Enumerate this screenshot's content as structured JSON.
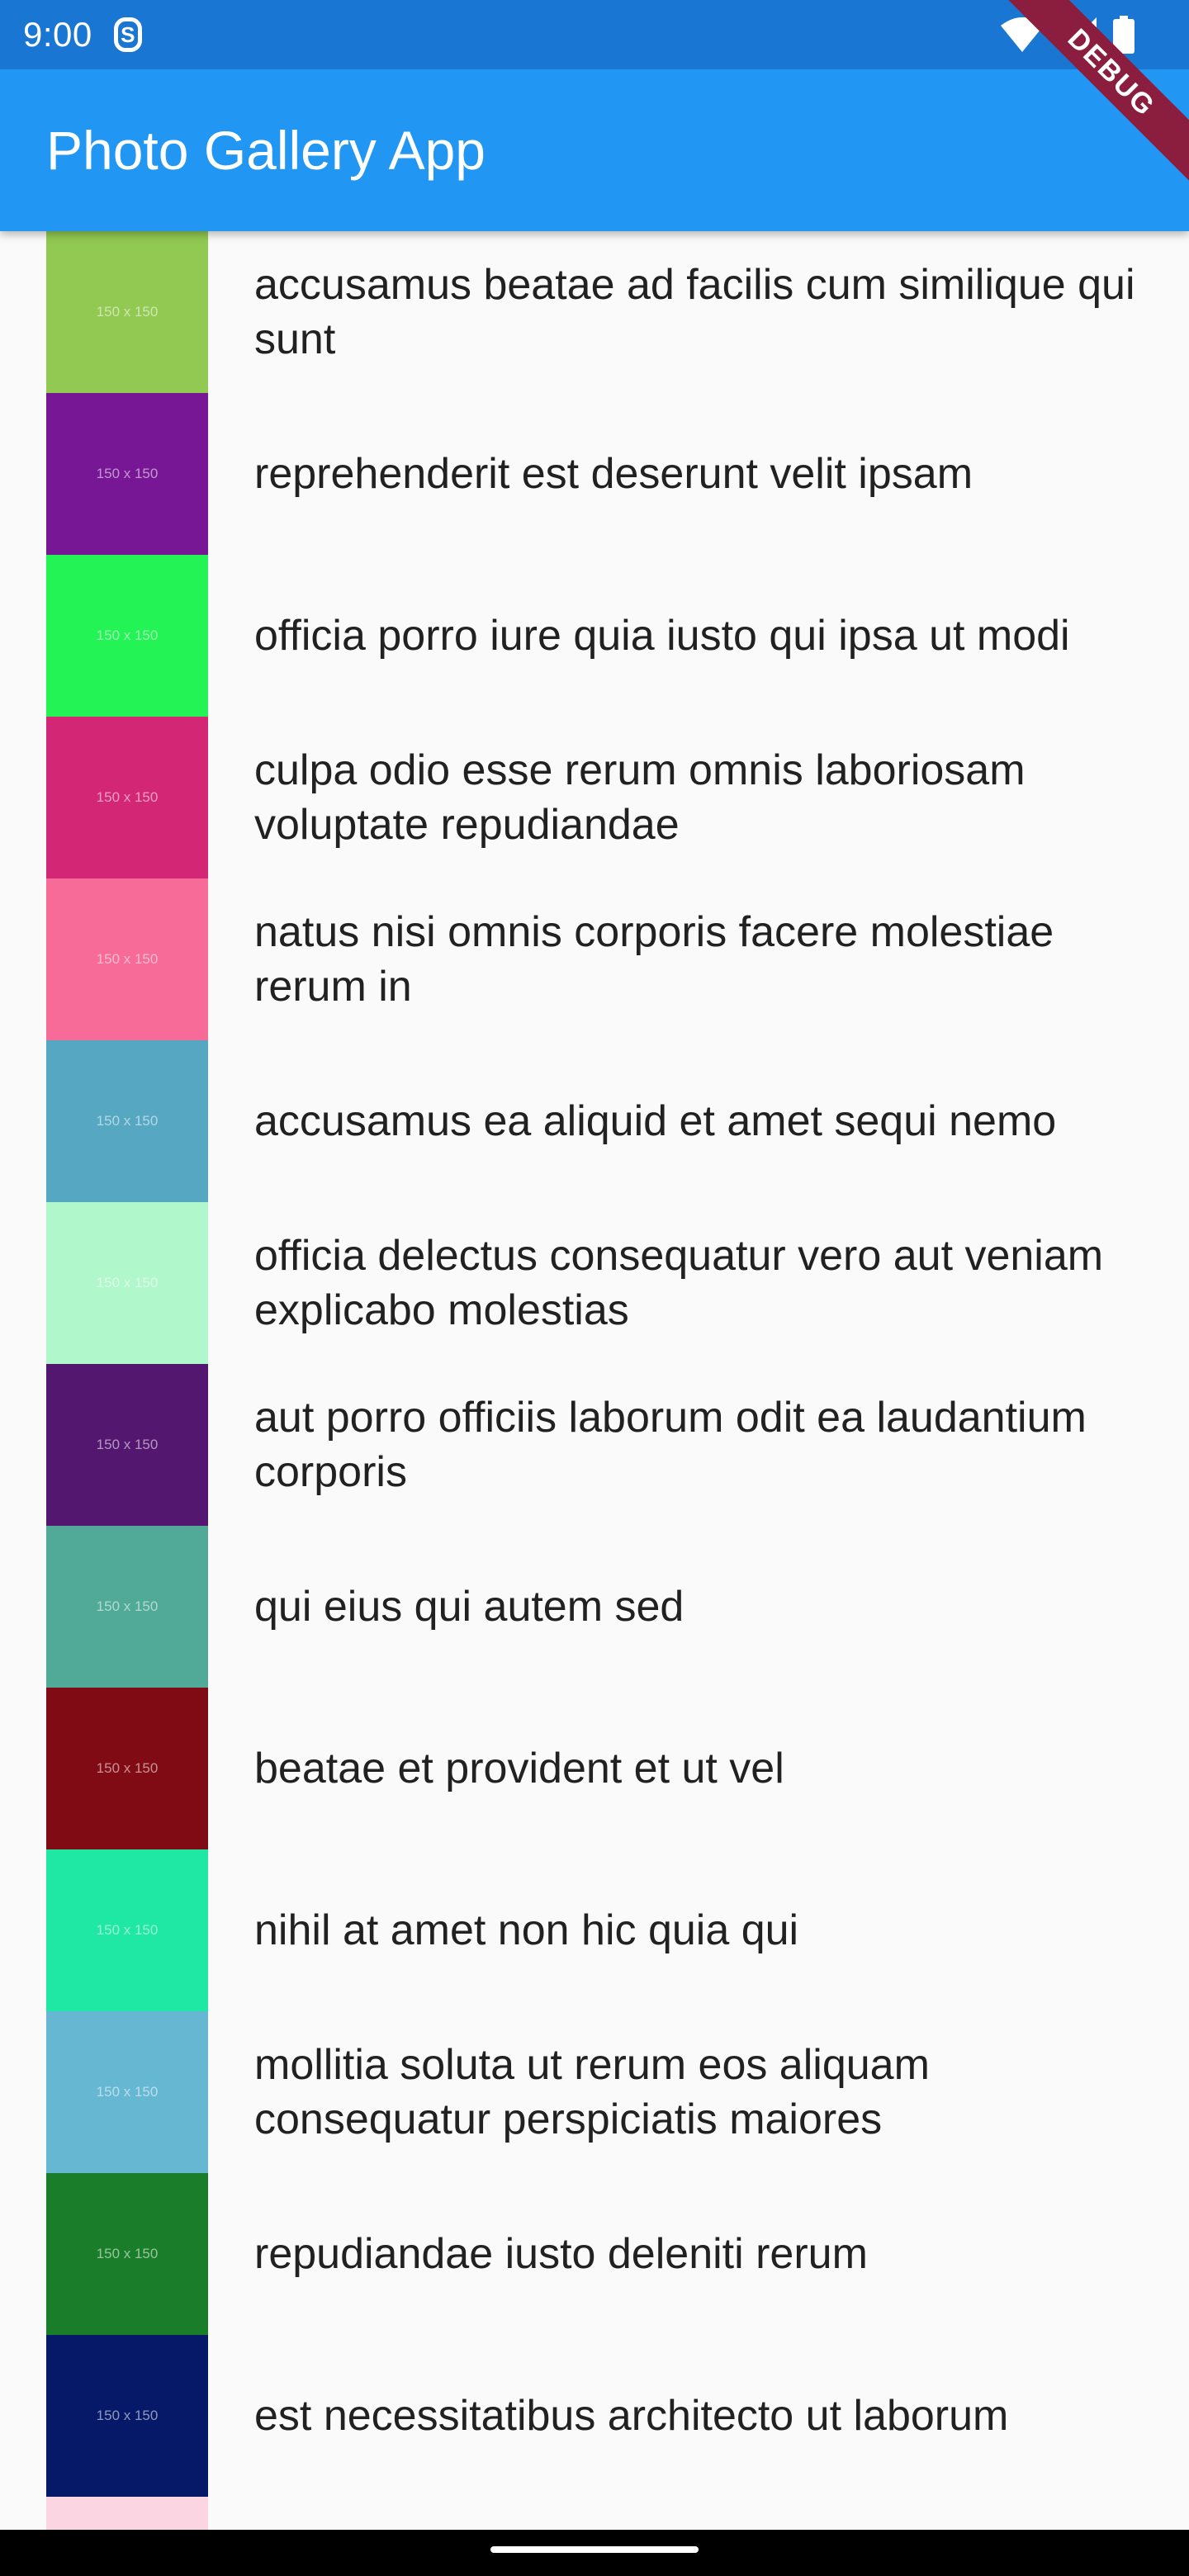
{
  "status_bar": {
    "time": "9:00",
    "s_icon": "S",
    "icons": [
      "s-icon",
      "wifi-icon",
      "signal-icon",
      "battery-icon"
    ]
  },
  "app_bar": {
    "title": "Photo Gallery App"
  },
  "debug_banner": "DEBUG",
  "photos": [
    {
      "title": "accusamus beatae ad facilis cum similique qui sunt",
      "color": "#92c952",
      "thumb_text": "150 x 150"
    },
    {
      "title": "reprehenderit est deserunt velit ipsam",
      "color": "#771796",
      "thumb_text": "150 x 150"
    },
    {
      "title": "officia porro iure quia iusto qui ipsa ut modi",
      "color": "#24f355",
      "thumb_text": "150 x 150"
    },
    {
      "title": "culpa odio esse rerum omnis laboriosam voluptate repudiandae",
      "color": "#d32776",
      "thumb_text": "150 x 150"
    },
    {
      "title": "natus nisi omnis corporis facere molestiae rerum in",
      "color": "#f66b97",
      "thumb_text": "150 x 150"
    },
    {
      "title": "accusamus ea aliquid et amet sequi nemo",
      "color": "#56a8c2",
      "thumb_text": "150 x 150"
    },
    {
      "title": "officia delectus consequatur vero aut veniam explicabo molestias",
      "color": "#b0f7cc",
      "thumb_text": "150 x 150"
    },
    {
      "title": "aut porro officiis laborum odit ea laudantium corporis",
      "color": "#54176f",
      "thumb_text": "150 x 150"
    },
    {
      "title": "qui eius qui autem sed",
      "color": "#51aa97",
      "thumb_text": "150 x 150"
    },
    {
      "title": "beatae et provident et ut vel",
      "color": "#810b14",
      "thumb_text": "150 x 150"
    },
    {
      "title": "nihil at amet non hic quia qui",
      "color": "#1ee8a4",
      "thumb_text": "150 x 150"
    },
    {
      "title": "mollitia soluta ut rerum eos aliquam consequatur perspiciatis maiores",
      "color": "#66b7d2",
      "thumb_text": "150 x 150"
    },
    {
      "title": "repudiandae iusto deleniti rerum",
      "color": "#197d29",
      "thumb_text": "150 x 150"
    },
    {
      "title": "est necessitatibus architecto ut laborum",
      "color": "#061969",
      "thumb_text": "150 x 150"
    },
    {
      "title": "",
      "color": "#fcd5e3",
      "thumb_text": ""
    }
  ]
}
